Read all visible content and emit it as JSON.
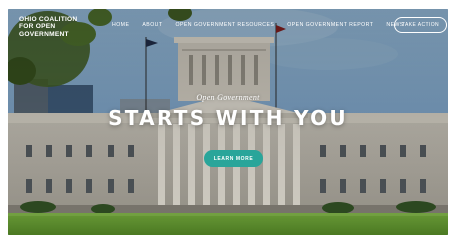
{
  "brand": {
    "line1": "OHIO COALITION",
    "line2": "FOR OPEN",
    "line3": "GOVERNMENT"
  },
  "nav": {
    "items": [
      {
        "label": "HOME"
      },
      {
        "label": "ABOUT"
      },
      {
        "label": "OPEN GOVERNMENT RESOURCES"
      },
      {
        "label": "OPEN GOVERNMENT REPORT"
      },
      {
        "label": "NEWS"
      }
    ],
    "cta_label": "TAKE ACTION"
  },
  "hero": {
    "kicker": "Open Government",
    "headline": "STARTS WITH YOU",
    "button_label": "LEARN MORE"
  },
  "colors": {
    "accent": "#29a59a",
    "text": "#ffffff"
  }
}
